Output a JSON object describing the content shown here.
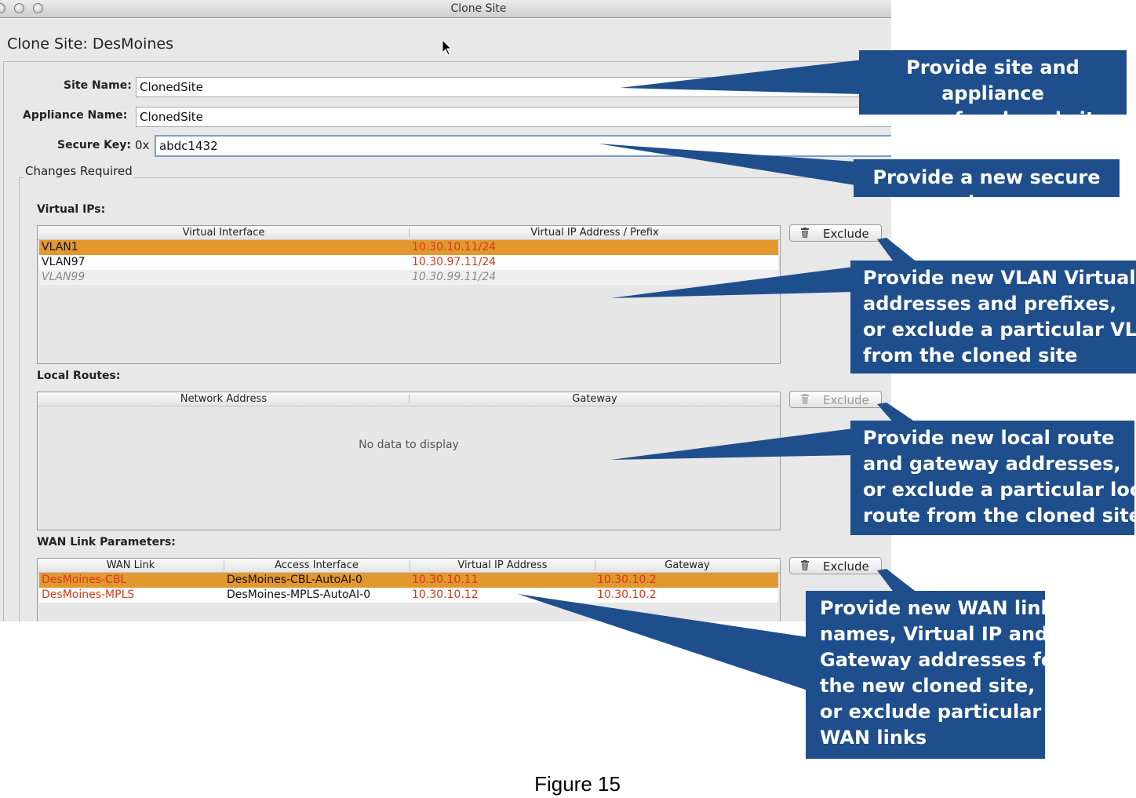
{
  "window": {
    "title": "Clone Site",
    "dialog_title": "Clone Site: DesMoines"
  },
  "form": {
    "site_name_label": "Site Name:",
    "site_name_value": "ClonedSite",
    "appliance_name_label": "Appliance Name:",
    "appliance_name_value": "ClonedSite",
    "secure_key_label": "Secure Key:",
    "secure_key_prefix": "0x",
    "secure_key_value": "abdc1432"
  },
  "changes_required_label": "Changes Required",
  "virtual_ips": {
    "section_label": "Virtual IPs:",
    "columns": [
      "Virtual Interface",
      "Virtual IP Address / Prefix"
    ],
    "rows": [
      {
        "interface": "VLAN1",
        "address": "10.30.10.11/24",
        "state": "selected"
      },
      {
        "interface": "VLAN97",
        "address": "10.30.97.11/24",
        "state": "normal"
      },
      {
        "interface": "VLAN99",
        "address": "10.30.99.11/24",
        "state": "excluded"
      }
    ],
    "exclude_label": "Exclude"
  },
  "local_routes": {
    "section_label": "Local Routes:",
    "columns": [
      "Network Address",
      "Gateway"
    ],
    "empty_text": "No data to display",
    "exclude_label": "Exclude"
  },
  "wan_links": {
    "section_label": "WAN Link Parameters:",
    "columns": [
      "WAN Link",
      "Access Interface",
      "Virtual IP Address",
      "Gateway"
    ],
    "rows": [
      {
        "wan_link": "DesMoines-CBL",
        "access_interface": "DesMoines-CBL-AutoAI-0",
        "virtual_ip": "10.30.10.11",
        "gateway": "10.30.10.2",
        "state": "selected"
      },
      {
        "wan_link": "DesMoines-MPLS",
        "access_interface": "DesMoines-MPLS-AutoAI-0",
        "virtual_ip": "10.30.10.12",
        "gateway": "10.30.10.2",
        "state": "normal"
      }
    ],
    "exclude_label": "Exclude"
  },
  "callouts": {
    "site_names": [
      "Provide site and appliance",
      "names for cloned site"
    ],
    "secure_key": [
      "Provide  a new secure key"
    ],
    "vlan": [
      "Provide new VLAN Virtual IP",
      "addresses and prefixes,",
      "or exclude a particular VLAN",
      "from the cloned site"
    ],
    "routes": [
      "Provide new local route",
      "and gateway addresses,",
      "or exclude a particular local",
      "route from the cloned site"
    ],
    "wan": [
      "Provide new WAN link",
      "names, Virtual IP and",
      "Gateway addresses for",
      "the new cloned site,",
      "or exclude particular",
      "WAN links"
    ]
  },
  "colors": {
    "callout_blue": "#1f4e8c",
    "selection_orange": "#e3982e",
    "value_red": "#d33a1e"
  },
  "caption": "Figure 15"
}
